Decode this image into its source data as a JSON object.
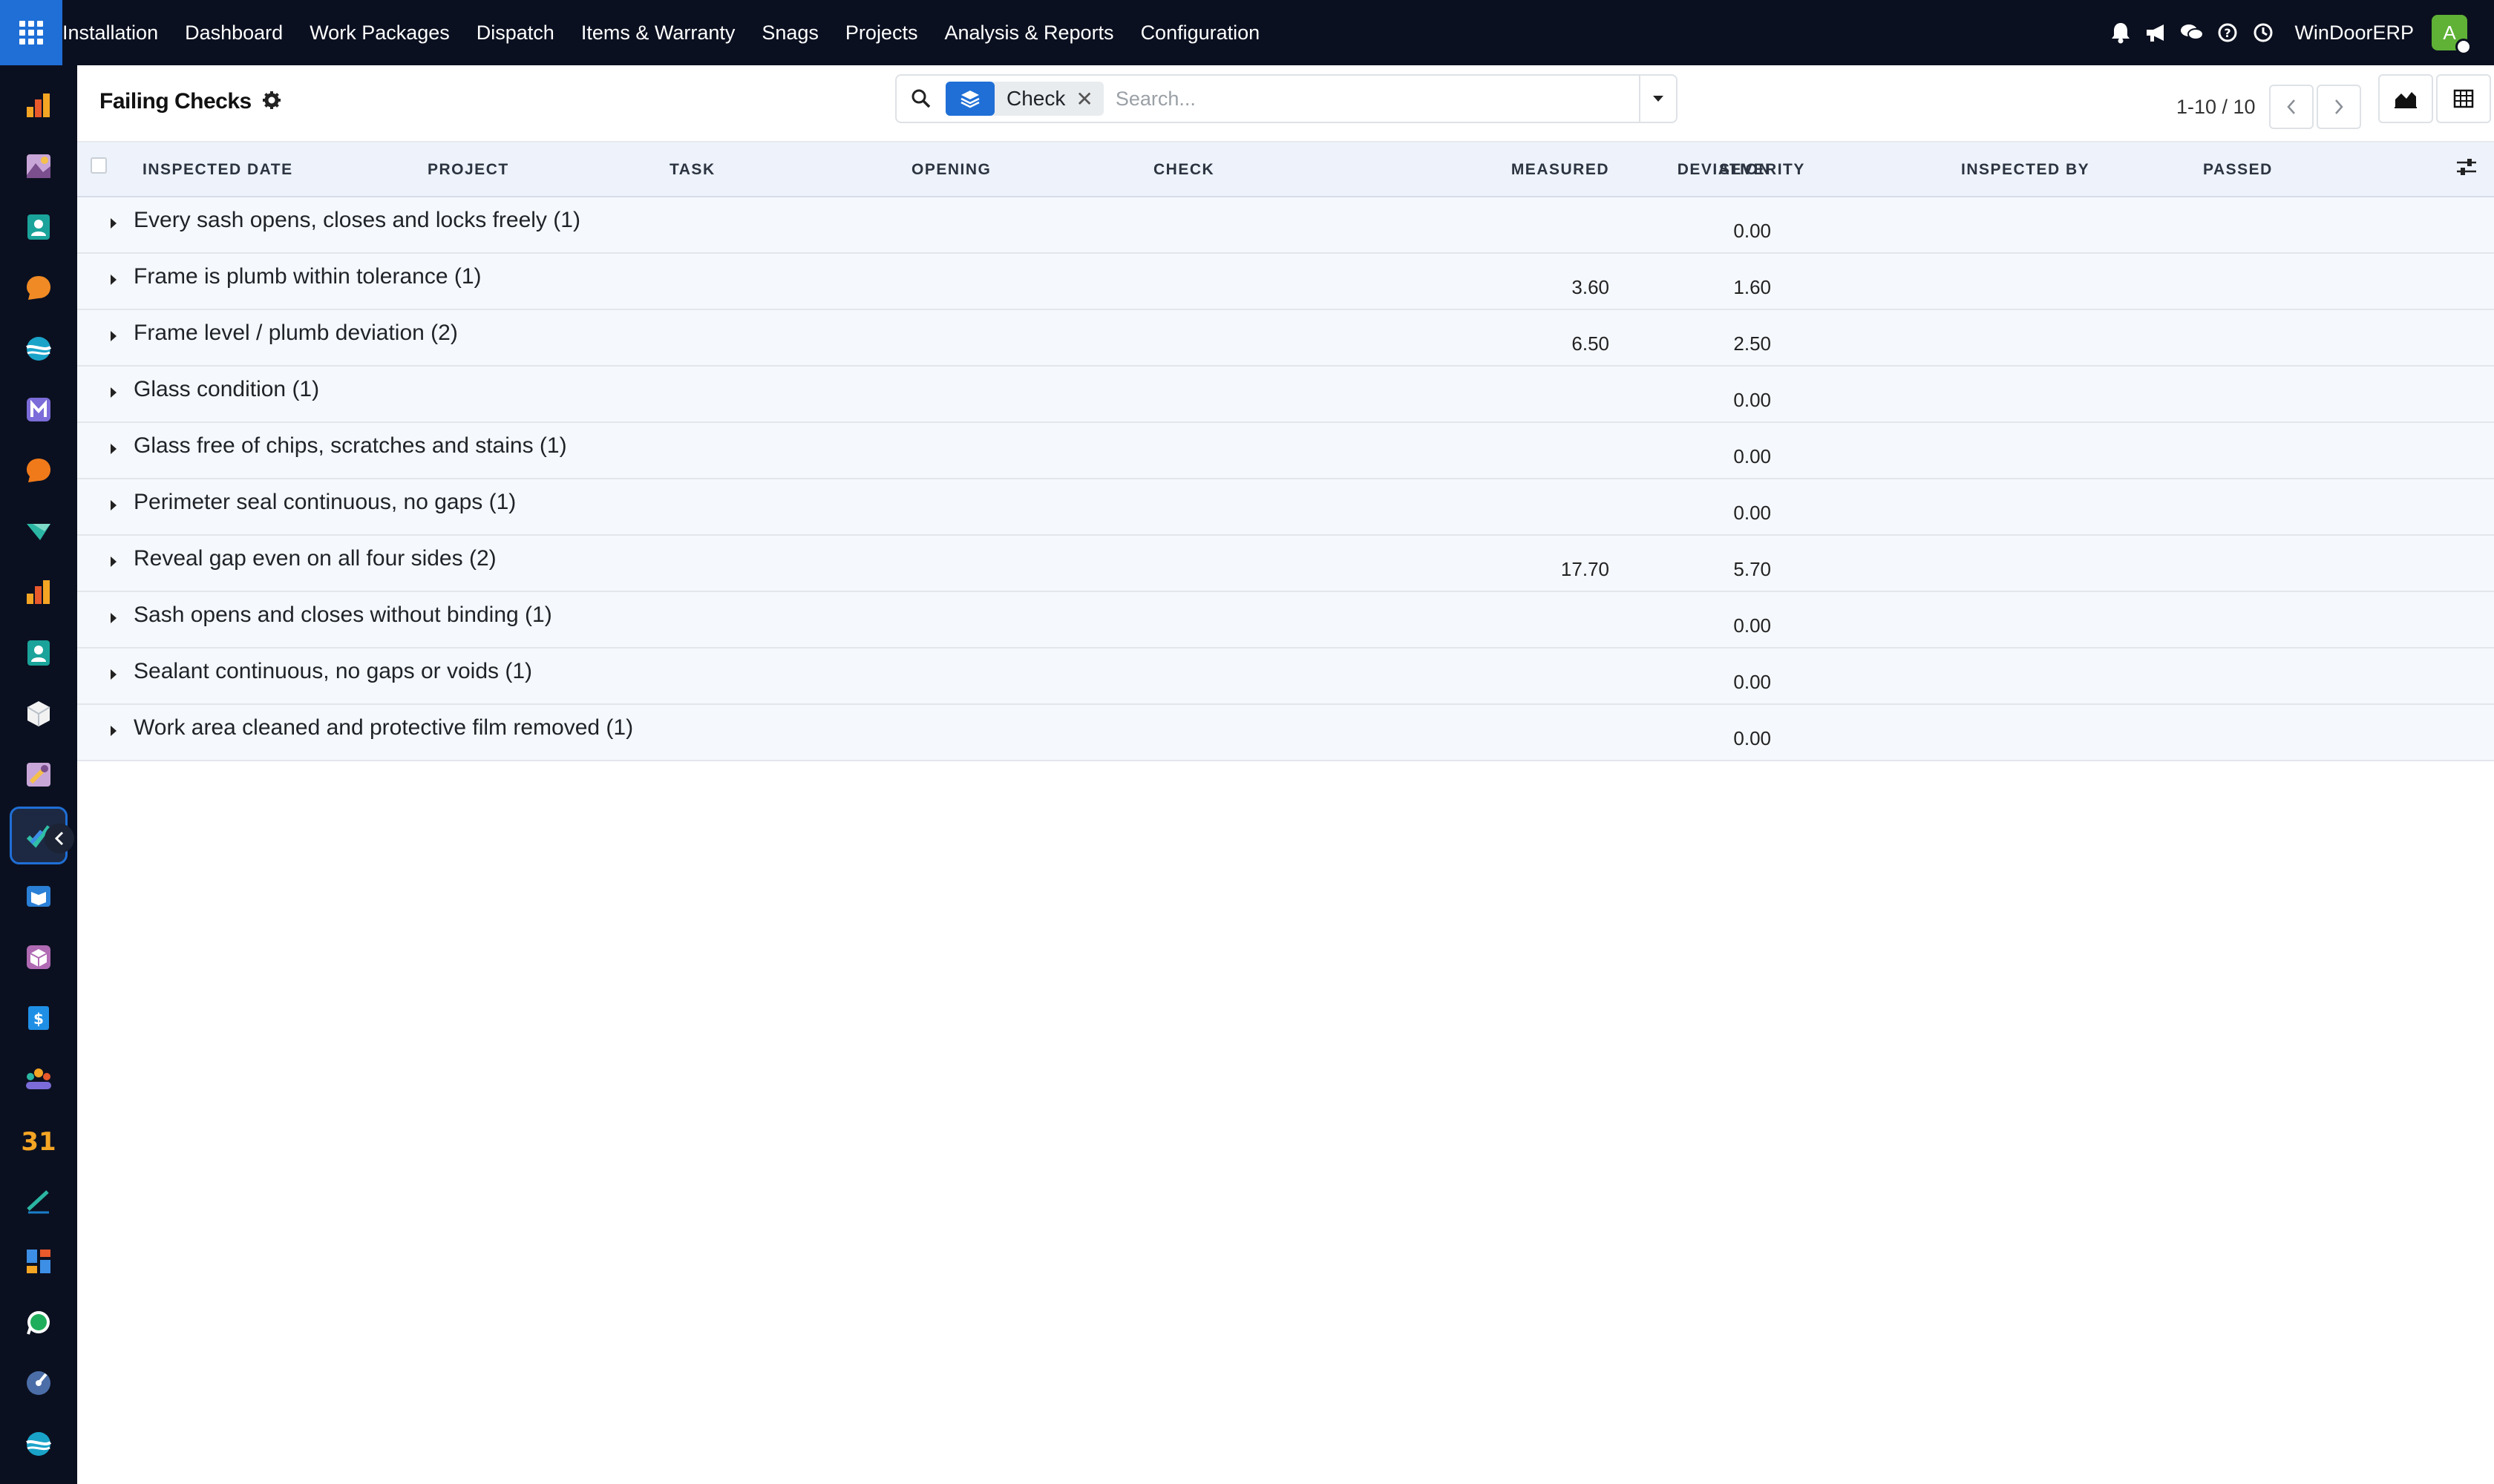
{
  "topnav": {
    "app_name": "Installation",
    "menu": [
      "Dashboard",
      "Work Packages",
      "Dispatch",
      "Items & Warranty",
      "Snags",
      "Projects",
      "Analysis & Reports",
      "Configuration"
    ],
    "company": "WinDoorERP",
    "avatar_letter": "A",
    "icons": [
      "bell-icon",
      "megaphone-icon",
      "chat-icon",
      "help-icon",
      "clock-icon"
    ]
  },
  "control": {
    "title": "Failing Checks",
    "facet_label": "Check",
    "search_placeholder": "Search...",
    "pager": "1-10 / 10"
  },
  "table": {
    "columns": [
      "Inspected Date",
      "Project",
      "Task",
      "Opening",
      "Check",
      "Measured",
      "Deviation",
      "Severity",
      "Inspected By",
      "Passed"
    ],
    "groups": [
      {
        "label": "Every sash opens, closes and locks freely (1)",
        "measured": "",
        "deviation": "0.00"
      },
      {
        "label": "Frame is plumb within tolerance (1)",
        "measured": "3.60",
        "deviation": "1.60"
      },
      {
        "label": "Frame level / plumb deviation (2)",
        "measured": "6.50",
        "deviation": "2.50"
      },
      {
        "label": "Glass condition (1)",
        "measured": "",
        "deviation": "0.00"
      },
      {
        "label": "Glass free of chips, scratches and stains (1)",
        "measured": "",
        "deviation": "0.00"
      },
      {
        "label": "Perimeter seal continuous, no gaps (1)",
        "measured": "",
        "deviation": "0.00"
      },
      {
        "label": "Reveal gap even on all four sides (2)",
        "measured": "17.70",
        "deviation": "5.70"
      },
      {
        "label": "Sash opens and closes without binding (1)",
        "measured": "",
        "deviation": "0.00"
      },
      {
        "label": "Sealant continuous, no gaps or voids (1)",
        "measured": "",
        "deviation": "0.00"
      },
      {
        "label": "Work area cleaned and protective film removed (1)",
        "measured": "",
        "deviation": "0.00"
      }
    ]
  },
  "colors": {
    "nav_bg": "#0b1020",
    "accent": "#1f6fd6",
    "header_bg": "#eef3fb",
    "avatar": "#5fb236"
  }
}
